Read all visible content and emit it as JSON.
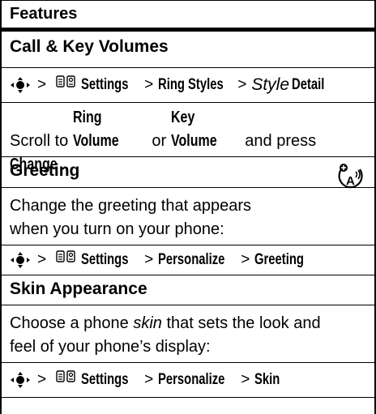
{
  "header": {
    "title": "Features"
  },
  "sections": [
    {
      "title": "Call & Key Volumes",
      "path": {
        "parts": [
          "Settings",
          "Ring Styles"
        ],
        "italic": "Style",
        "last": "Detail"
      },
      "body_parts": [
        "Scroll to ",
        "Ring Volume",
        " or ",
        "Key Volume",
        " and press",
        "Change",
        "."
      ]
    },
    {
      "title": "Greeting",
      "icon": "network-feature-icon",
      "body_lines": [
        "Change the greeting that appears",
        "when you turn on your phone:"
      ],
      "path": {
        "parts": [
          "Settings",
          "Personalize",
          "Greeting"
        ]
      }
    },
    {
      "title": "Skin Appearance",
      "body_lines": [
        "feel of your phone’s display:"
      ],
      "body_first": {
        "pre": "Choose a phone ",
        "italic": "skin",
        "post": " that sets the look and"
      },
      "path": {
        "parts": [
          "Settings",
          "Personalize",
          "Skin"
        ]
      }
    }
  ],
  "symbols": {
    "arrow": ">"
  },
  "icons": {
    "nav_key": "nav-key-icon",
    "menu": "settings-menu-icon"
  }
}
